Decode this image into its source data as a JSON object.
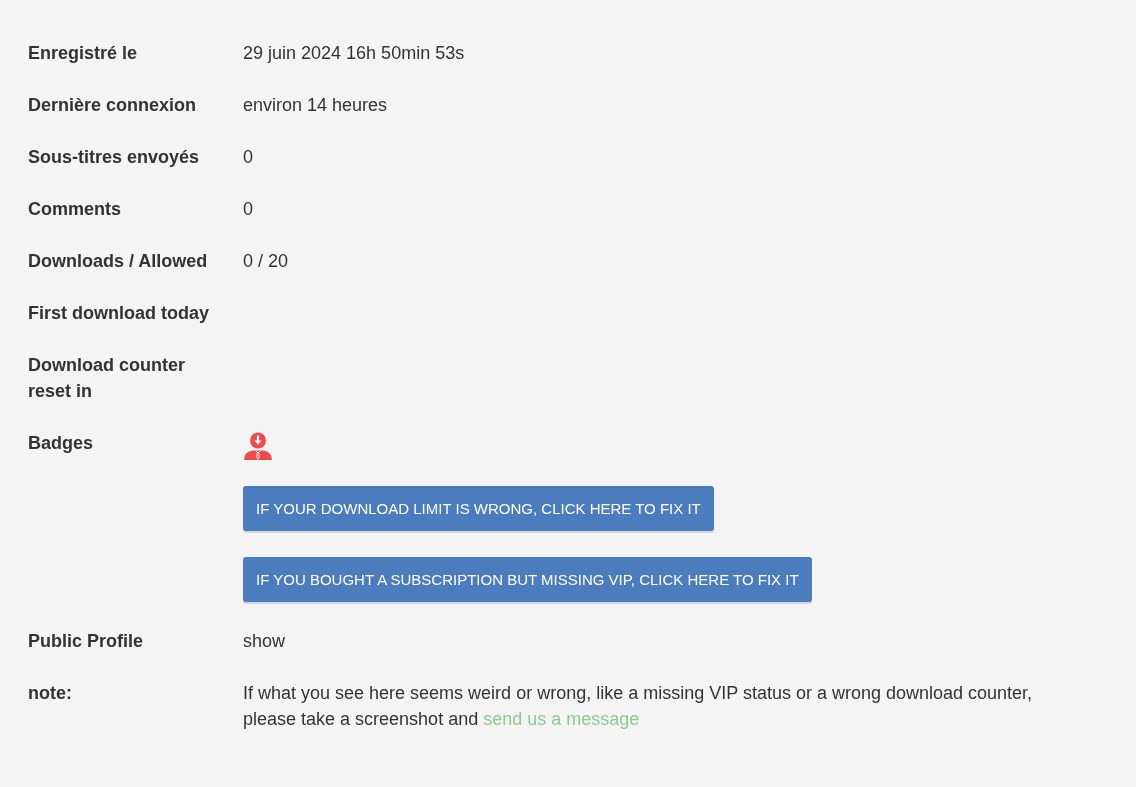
{
  "profile_fields": [
    {
      "kind": "text",
      "label": "Enregistré le",
      "value": "29 juin 2024 16h 50min 53s"
    },
    {
      "kind": "text",
      "label": "Dernière connexion",
      "value": "environ 14 heures"
    },
    {
      "kind": "text",
      "label": "Sous-titres envoyés",
      "value": "0"
    },
    {
      "kind": "text",
      "label": "Comments",
      "value": "0"
    },
    {
      "kind": "text",
      "label": "Downloads / Allowed",
      "value": "0 / 20"
    },
    {
      "kind": "text",
      "label": "First download today"
    },
    {
      "kind": "text",
      "label": "Download counter reset in"
    },
    {
      "kind": "badges",
      "label": "Badges"
    },
    {
      "kind": "button",
      "text": "IF YOUR DOWNLOAD LIMIT IS WRONG, CLICK HERE TO FIX IT"
    },
    {
      "kind": "button",
      "text": "IF YOU BOUGHT A SUBSCRIPTION BUT MISSING VIP, CLICK HERE TO FIX IT"
    },
    {
      "kind": "text",
      "label": "Public Profile",
      "value": "show"
    },
    {
      "kind": "note",
      "label": "note:",
      "text": "If what you see here seems weird or wrong, like a missing VIP status or a wrong download counter, please take a screenshot and",
      "link": "send us a message"
    }
  ]
}
